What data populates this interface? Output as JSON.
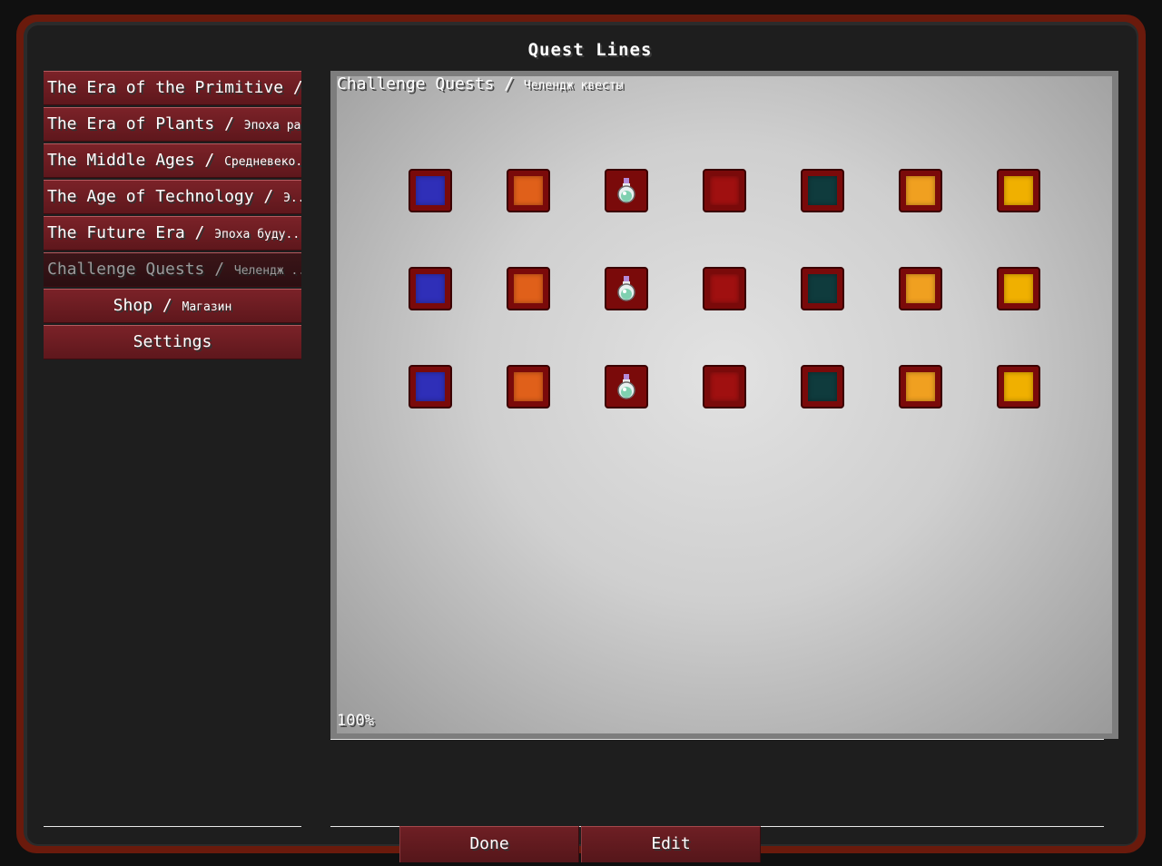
{
  "window": {
    "title": "Quest Lines"
  },
  "quest_lines": [
    {
      "label": "The Era of the Primitive / ...",
      "sub": "",
      "active": false
    },
    {
      "label": "The Era of Plants / ",
      "sub": "Эпоха ра...",
      "active": false
    },
    {
      "label": "The Middle Ages / ",
      "sub": "Средневеко...",
      "active": false
    },
    {
      "label": "The Age of Technology / ",
      "sub": "Э...",
      "active": false
    },
    {
      "label": "The Future Era / ",
      "sub": "Эпоха буду...",
      "active": false
    },
    {
      "label": "Challenge Quests / ",
      "sub": "Челендж ...",
      "active": true
    },
    {
      "label": "Shop / ",
      "sub": "Магазин",
      "active": false
    },
    {
      "label": "Settings",
      "sub": "",
      "active": false
    }
  ],
  "canvas": {
    "title": "Challenge Quests / ",
    "title_sub": "Челендж квесты",
    "zoom": "100%"
  },
  "quests": {
    "columns": [
      "blue",
      "orange",
      "potion",
      "red",
      "teal",
      "amber",
      "gold"
    ],
    "colors": {
      "blue": "#2f2fb8",
      "orange": "#e0601a",
      "red": "#a01010",
      "teal": "#0f3b3d",
      "amber": "#f0a020",
      "gold": "#f0b000"
    },
    "rows": 3
  },
  "buttons": {
    "done": "Done",
    "edit": "Edit"
  }
}
